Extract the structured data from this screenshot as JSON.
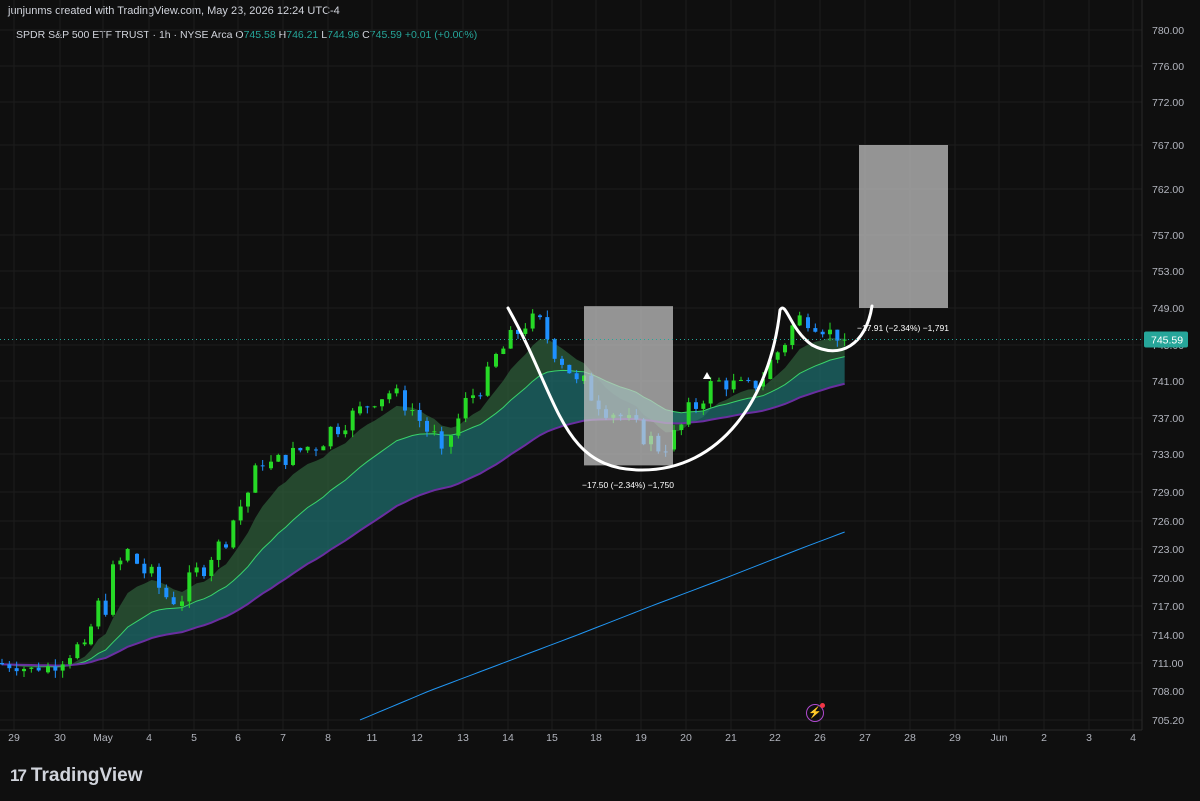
{
  "header": {
    "attribution": "junjunms created with TradingView.com, May 23, 2026 12:24 UTC-4"
  },
  "legend": {
    "symbol": "SPDR S&P 500 ETF TRUST · 1h · NYSE Arca",
    "o_label": "O",
    "o_value": "745.58",
    "h_label": "H",
    "h_value": "746.21",
    "l_label": "L",
    "l_value": "744.96",
    "c_label": "C",
    "c_value": "745.59",
    "change": "+0.01 (+0.00%)"
  },
  "footer": {
    "brand": "TradingView",
    "brand_mark": "17"
  },
  "colors": {
    "background": "#0f0f0f",
    "up": "#26d926",
    "down": "#1e90ff",
    "price_tag": "#26a69a",
    "long_ma": "#2196f3"
  },
  "chart_data": {
    "type": "candlestick",
    "y_axis": {
      "ticks": [
        "780.00",
        "776.00",
        "772.00",
        "767.00",
        "762.00",
        "757.00",
        "753.00",
        "749.00",
        "745.00",
        "741.00",
        "737.00",
        "733.00",
        "729.00",
        "726.00",
        "723.00",
        "720.00",
        "717.00",
        "714.00",
        "711.00",
        "708.00",
        "705.20"
      ],
      "range": [
        704,
        781
      ]
    },
    "current_price": "745.59",
    "x_axis": {
      "labels": [
        "29",
        "30",
        "May",
        "4",
        "5",
        "6",
        "7",
        "8",
        "11",
        "12",
        "13",
        "14",
        "15",
        "18",
        "19",
        "20",
        "21",
        "22",
        "26",
        "27",
        "28",
        "29",
        "Jun",
        "2",
        "3",
        "4"
      ]
    },
    "candles": [
      {
        "date": "29",
        "o": 711.0,
        "h": 712.2,
        "l": 709.0,
        "c": 710.2
      },
      {
        "date": "30",
        "o": 710.0,
        "h": 714.0,
        "l": 708.4,
        "c": 713.2
      },
      {
        "date": "May",
        "o": 713.0,
        "h": 725.0,
        "l": 712.0,
        "c": 723.0
      },
      {
        "date": "4",
        "o": 722.5,
        "h": 723.0,
        "l": 714.8,
        "c": 717.2
      },
      {
        "date": "5",
        "o": 717.0,
        "h": 724.5,
        "l": 716.5,
        "c": 723.8
      },
      {
        "date": "6",
        "o": 723.5,
        "h": 733.0,
        "l": 723.0,
        "c": 731.8
      },
      {
        "date": "7",
        "o": 731.5,
        "h": 735.5,
        "l": 730.0,
        "c": 733.8
      },
      {
        "date": "8",
        "o": 733.5,
        "h": 738.5,
        "l": 730.0,
        "c": 737.8
      },
      {
        "date": "11",
        "o": 737.5,
        "h": 741.0,
        "l": 737.0,
        "c": 740.2
      },
      {
        "date": "12",
        "o": 740.0,
        "h": 740.5,
        "l": 732.0,
        "c": 733.6
      },
      {
        "date": "13",
        "o": 733.8,
        "h": 744.0,
        "l": 733.0,
        "c": 742.6
      },
      {
        "date": "14",
        "o": 742.6,
        "h": 749.0,
        "l": 742.0,
        "c": 748.4
      },
      {
        "date": "15",
        "o": 748.2,
        "h": 749.0,
        "l": 740.5,
        "c": 741.2
      },
      {
        "date": "18",
        "o": 741.0,
        "h": 743.8,
        "l": 735.0,
        "c": 737.2
      },
      {
        "date": "19",
        "o": 737.0,
        "h": 739.0,
        "l": 732.0,
        "c": 733.2
      },
      {
        "date": "20",
        "o": 733.5,
        "h": 742.0,
        "l": 733.0,
        "c": 741.0
      },
      {
        "date": "21",
        "o": 741.0,
        "h": 742.6,
        "l": 737.5,
        "c": 740.2
      },
      {
        "date": "22",
        "o": 740.4,
        "h": 749.0,
        "l": 740.0,
        "c": 748.2
      },
      {
        "date": "26",
        "o": 748.0,
        "h": 749.2,
        "l": 744.8,
        "c": 745.59
      }
    ],
    "annotations": [
      {
        "text": "−17.50 (−2.34%) −1,750"
      },
      {
        "text": "−17.91 (−2.34%) −1,791"
      }
    ]
  }
}
